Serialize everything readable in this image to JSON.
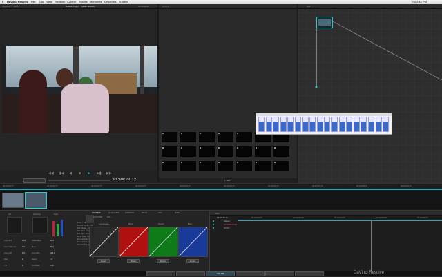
{
  "menubar": {
    "app_name": "DaVinci Resolve",
    "items": [
      "File",
      "Edit",
      "View",
      "Session",
      "Control",
      "Nodes",
      "Memories",
      "Dynamics",
      "Tracker"
    ],
    "clock": "Thu 2:42 PM"
  },
  "viewer": {
    "project_title": "Default Project : Master Session",
    "header_left": "3DLPFIX",
    "header_left2": "RPG",
    "header_right": "16:40:00:00",
    "timecode": "01:04:20:12"
  },
  "stills": {
    "tab1": "STILLS",
    "tab2": "",
    "thumb_count": 21,
    "footer_left": "",
    "footer_mid": "1 sets"
  },
  "nodes": {
    "tab": "GUI"
  },
  "lut_popup": {
    "cells": 18
  },
  "timeline": {
    "ticks": [
      "01:04:00:17",
      "01:04:01:17",
      "01:04:02:17",
      "01:04:03:17",
      "01:04:04:17",
      "01:04:05:17",
      "01:04:06:17",
      "01:04:07:17",
      "01:04:08:17",
      "01:04:09:17"
    ]
  },
  "primaries": {
    "section_titles": [
      "Lift",
      "Gamma",
      "Gain"
    ],
    "params": [
      {
        "label": "Lum Mix",
        "value": "100"
      },
      {
        "label": "Lum Gamma",
        "value": "0.0"
      },
      {
        "label": "Lum Lift",
        "value": "0.0"
      },
      {
        "label": "Pan",
        "value": "0"
      },
      {
        "label": "Tilt",
        "value": "0"
      }
    ],
    "params2": [
      {
        "label": "Saturation",
        "value": "50.0"
      },
      {
        "label": "Hue",
        "value": "50.0"
      },
      {
        "label": "Lum Mix",
        "value": "100.0"
      },
      {
        "label": "Zoom",
        "value": "1.0"
      },
      {
        "label": "Contrast",
        "value": "1.00"
      }
    ],
    "info_lines": [
      "Proxy : Off",
      "Render Cache : Off",
      "Full Resize : Off",
      "Ref Mode : Gallery",
      "Ref Type : Wipe",
      "Wipe Style : Horizontal",
      "Remote Grading : Disabled",
      "Remote Current : Lock Sym",
      "Remote Display : Mixed"
    ]
  },
  "curves": {
    "tabs": [
      "CURVES",
      "QUALIFIER",
      "WINDOW",
      "BLUR",
      "KEY",
      "SIZE"
    ],
    "subtabs": [
      "CUSTOM",
      "HSL"
    ],
    "panels": [
      {
        "label": "Luminance",
        "color": "#2a2a2a",
        "reset": "Reset"
      },
      {
        "label": "Red",
        "color": "#b01010",
        "reset": "Reset"
      },
      {
        "label": "Green",
        "color": "#0e7a18",
        "reset": "Reset"
      },
      {
        "label": "Blue",
        "color": "#1a3a9a",
        "reset": "Reset"
      }
    ]
  },
  "keyframes": {
    "tabs": [
      "KEY",
      "",
      "",
      ""
    ],
    "timecode": "01:04:20:12",
    "ticks": [
      "01:04:00:00",
      "01:04:02:00",
      "01:04:04:00",
      "01:04:06:00",
      "01:04:08:00"
    ],
    "tracks": [
      "Master",
      "CORRECTOR",
      "PCDC"
    ]
  },
  "bottombar": {
    "tabs": [
      "",
      "",
      "COLOR",
      "",
      "",
      ""
    ],
    "app_title": "DaVinci Resolve"
  }
}
